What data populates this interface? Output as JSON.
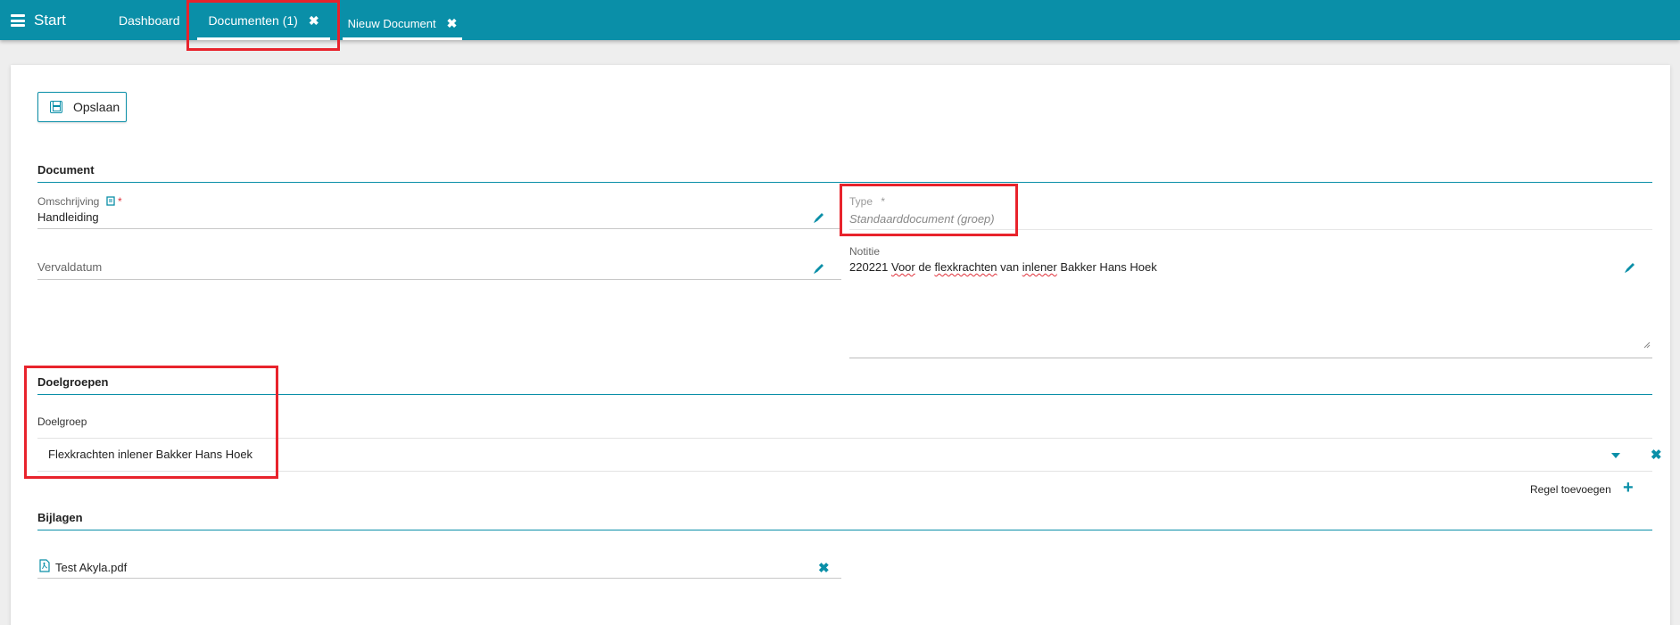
{
  "header": {
    "start_label": "Start",
    "tabs": [
      {
        "label": "Dashboard"
      },
      {
        "label": "Documenten (1)",
        "close": "✖"
      },
      {
        "label": "Nieuw Document",
        "close": "✖"
      }
    ]
  },
  "toolbar": {
    "save_label": "Opslaan"
  },
  "document": {
    "section_title": "Document",
    "omschrijving_label": "Omschrijving",
    "omschrijving_required": "*",
    "omschrijving_value": "Handleiding",
    "type_label": "Type",
    "type_required": "*",
    "type_value": "Standaarddocument (groep)",
    "vervaldatum_label": "Vervaldatum",
    "notitie_label": "Notitie",
    "notitie_parts": [
      "220221 ",
      "Voor",
      " de ",
      "flexkrachten",
      " van ",
      "inlener",
      " Bakker Hans Hoek"
    ]
  },
  "doelgroepen": {
    "section_title": "Doelgroepen",
    "column_label": "Doelgroep",
    "rows": [
      {
        "value": "Flexkrachten inlener Bakker Hans Hoek"
      }
    ],
    "add_row_label": "Regel toevoegen"
  },
  "bijlagen": {
    "section_title": "Bijlagen",
    "files": [
      {
        "name": "Test Akyla.pdf"
      }
    ]
  },
  "colors": {
    "accent": "#0a8fa8",
    "highlight": "#e8232c",
    "required": "#e0303a"
  }
}
